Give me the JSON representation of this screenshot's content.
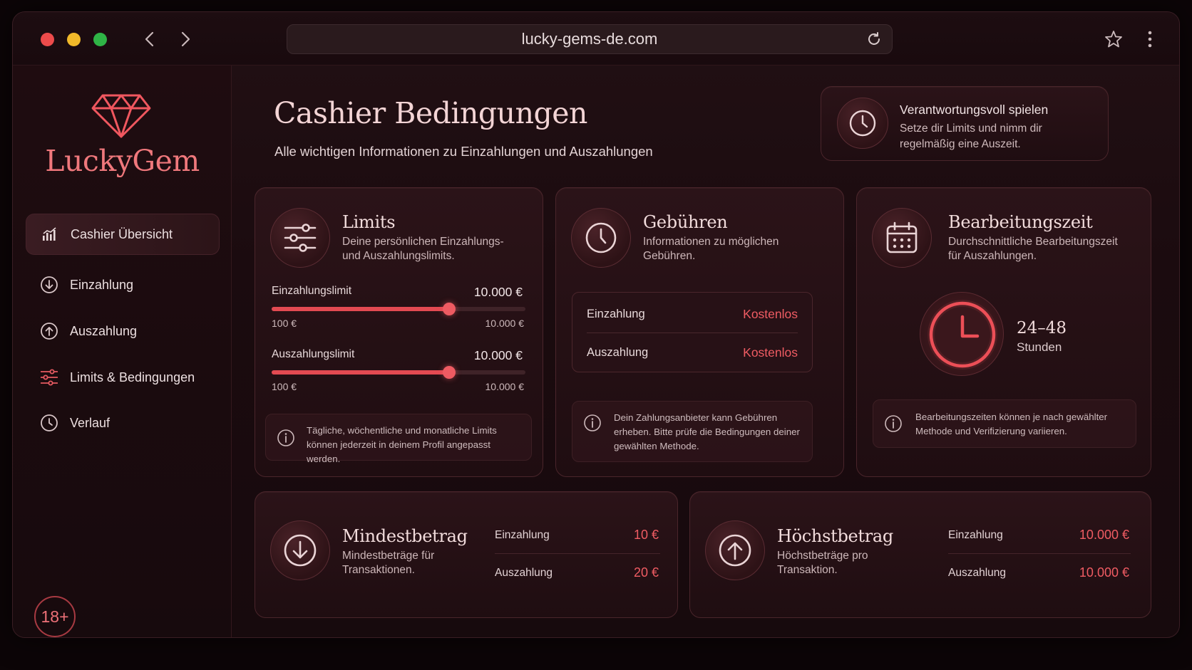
{
  "browser": {
    "url": "lucky-gems-de.com"
  },
  "brand": {
    "name": "LuckyGem",
    "age_badge": "18+"
  },
  "sidebar": {
    "items": [
      {
        "label": "Cashier Übersicht",
        "icon": "bar-chart-icon",
        "active": true
      },
      {
        "label": "Einzahlung",
        "icon": "arrow-down-circle-icon",
        "active": false
      },
      {
        "label": "Auszahlung",
        "icon": "arrow-up-circle-icon",
        "active": false
      },
      {
        "label": "Limits & Bedingungen",
        "icon": "sliders-icon",
        "active": false
      },
      {
        "label": "Verlauf",
        "icon": "clock-icon",
        "active": false
      }
    ]
  },
  "header": {
    "title": "Cashier Bedingungen",
    "subtitle": "Alle wichtigen Informationen zu Einzahlungen und Auszahlungen"
  },
  "responsible": {
    "title": "Verantwortungsvoll spielen",
    "desc": "Setze dir Limits und nimm dir regelmäßig eine Auszeit."
  },
  "limits": {
    "title": "Limits",
    "desc": "Deine persönlichen Einzahlungs- und Auszahlungslimits.",
    "deposit": {
      "label": "Einzahlungslimit",
      "value": "10.000 €",
      "min": "100 €",
      "max": "10.000 €",
      "fill_fraction": 0.7
    },
    "withdraw": {
      "label": "Auszahlungslimit",
      "value": "10.000 €",
      "min": "100 €",
      "max": "10.000 €",
      "fill_fraction": 0.7
    },
    "note": "Tägliche, wöchentliche und monatliche Limits können jederzeit in deinem Profil angepasst werden."
  },
  "fees": {
    "title": "Gebühren",
    "desc": "Informationen zu möglichen Gebühren.",
    "rows": [
      {
        "label": "Einzahlung",
        "value": "Kostenlos"
      },
      {
        "label": "Auszahlung",
        "value": "Kostenlos"
      }
    ],
    "note": "Dein Zahlungsanbieter kann Gebühren erheben. Bitte prüfe die Bedingungen deiner gewählten Methode."
  },
  "processing": {
    "title": "Bearbeitungszeit",
    "desc": "Durchschnittliche Bearbeitungszeit für Auszahlungen.",
    "time": "24–48",
    "unit": "Stunden",
    "note": "Bearbeitungszeiten können je nach gewählter Methode und Verifizierung variieren."
  },
  "minimum": {
    "title": "Mindestbetrag",
    "desc": "Mindestbeträge für Transaktionen.",
    "rows": [
      {
        "label": "Einzahlung",
        "value": "10 €"
      },
      {
        "label": "Auszahlung",
        "value": "20 €"
      }
    ]
  },
  "maximum": {
    "title": "Höchstbetrag",
    "desc": "Höchstbeträge pro Transaktion.",
    "rows": [
      {
        "label": "Einzahlung",
        "value": "10.000 €"
      },
      {
        "label": "Auszahlung",
        "value": "10.000 €"
      }
    ]
  },
  "colors": {
    "accent": "#ee5b62",
    "background": "#1b0b0f"
  }
}
